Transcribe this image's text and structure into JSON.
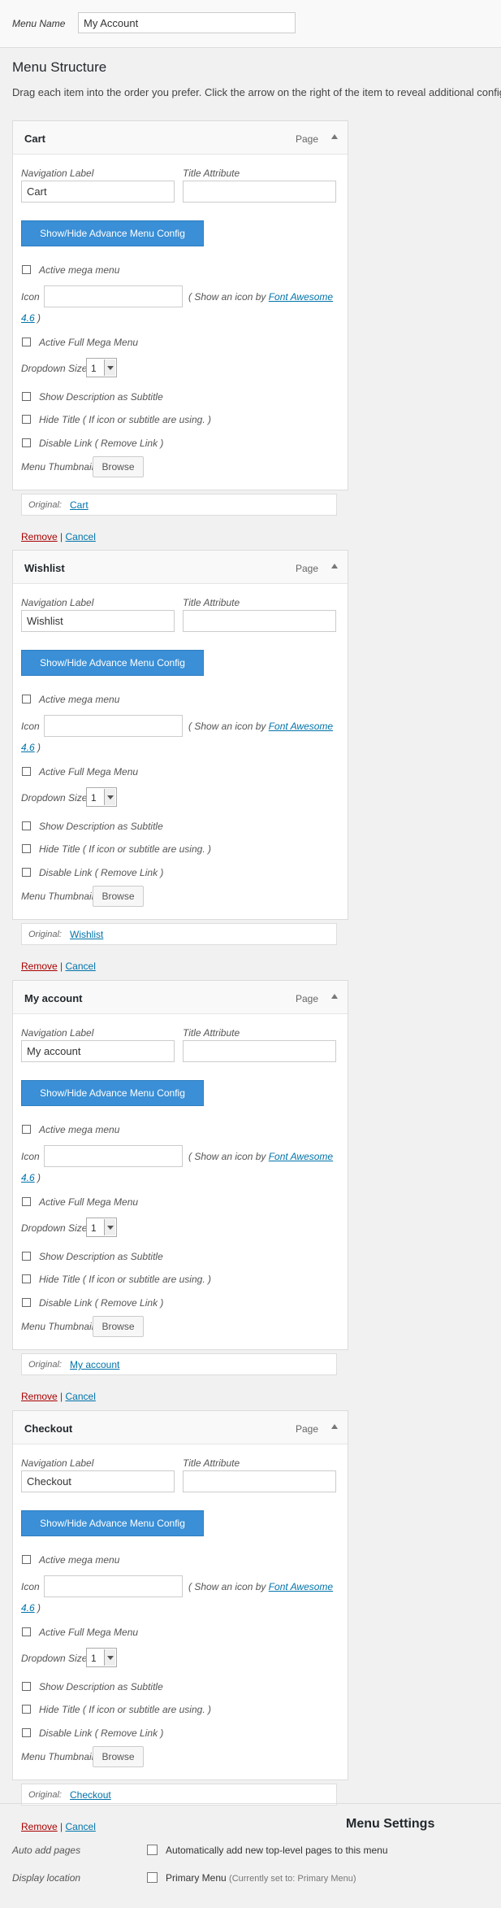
{
  "menu_name": {
    "label": "Menu Name",
    "value": "My Account"
  },
  "structure": {
    "title": "Menu Structure",
    "description": "Drag each item into the order you prefer. Click the arrow on the right of the item to reveal additional configuration options."
  },
  "common": {
    "nav_label": "Navigation Label",
    "title_attr": "Title Attribute",
    "advance_btn": "Show/Hide Advance Menu Config",
    "active_mega": "Active mega menu",
    "icon_label": "Icon",
    "icon_hint_pre": "( Show an icon by ",
    "icon_hint_link": "Font Awesome",
    "icon_hint_version": "4.6",
    "icon_hint_post": " )",
    "active_full_mega": "Active Full Mega Menu",
    "dropdown_size": "Dropdown Size",
    "dropdown_value": "1",
    "show_desc": "Show Description as Subtitle",
    "hide_title": "Hide Title ( If icon or subtitle are using. )",
    "disable_link": "Disable Link ( Remove Link )",
    "thumbnail": "Menu Thumbnail",
    "browse": "Browse",
    "original": "Original:",
    "remove": "Remove",
    "separator": "|",
    "cancel": "Cancel"
  },
  "items": [
    {
      "title": "Cart",
      "type": "Page",
      "nav_value": "Cart",
      "title_value": "",
      "original": "Cart"
    },
    {
      "title": "Wishlist",
      "type": "Page",
      "nav_value": "Wishlist",
      "title_value": "",
      "original": "Wishlist"
    },
    {
      "title": "My account",
      "type": "Page",
      "nav_value": "My account",
      "title_value": "",
      "original": "My account"
    },
    {
      "title": "Checkout",
      "type": "Page",
      "nav_value": "Checkout",
      "title_value": "",
      "original": "Checkout"
    }
  ],
  "settings": {
    "title": "Menu Settings",
    "auto_add_label": "Auto add pages",
    "auto_add_text": "Automatically add new top-level pages to this menu",
    "display_label": "Display location",
    "primary_text": "Primary Menu",
    "primary_note": "(Currently set to: Primary Menu)"
  }
}
